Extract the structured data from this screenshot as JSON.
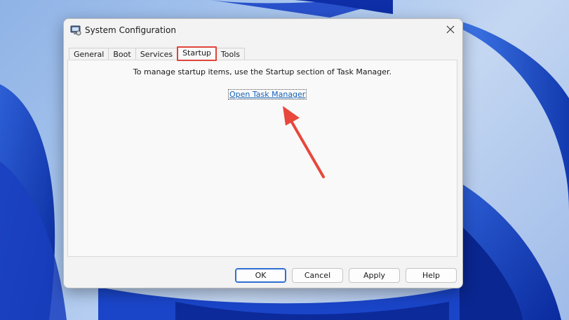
{
  "window": {
    "title": "System Configuration"
  },
  "tabs": [
    {
      "label": "General",
      "active": false
    },
    {
      "label": "Boot",
      "active": false
    },
    {
      "label": "Services",
      "active": false
    },
    {
      "label": "Startup",
      "active": true
    },
    {
      "label": "Tools",
      "active": false
    }
  ],
  "startup_tab": {
    "instruction": "To manage startup items, use the Startup section of Task Manager.",
    "link_label": "Open Task Manager"
  },
  "buttons": {
    "ok": "OK",
    "cancel": "Cancel",
    "apply": "Apply",
    "help": "Help"
  },
  "colors": {
    "highlight": "#e0443a",
    "link": "#1560b8",
    "default_button_border": "#2f6fd0"
  },
  "icons": {
    "app": "system-config-icon",
    "close": "close-icon",
    "annotation": "red-arrow-icon"
  }
}
